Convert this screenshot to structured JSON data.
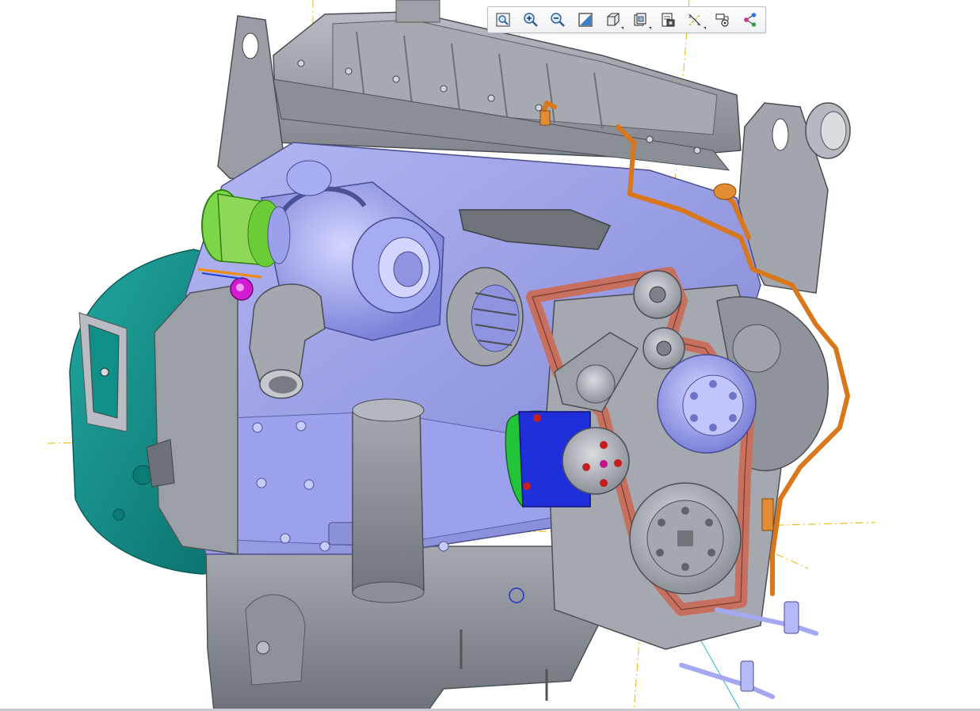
{
  "toolbar": {
    "buttons": [
      {
        "icon": "refit-icon",
        "tooltip": ""
      },
      {
        "icon": "zoom-in-icon",
        "tooltip": ""
      },
      {
        "icon": "zoom-out-icon",
        "tooltip": ""
      },
      {
        "icon": "repaint-icon",
        "tooltip": ""
      },
      {
        "icon": "display-style-icon",
        "tooltip": ""
      },
      {
        "icon": "saved-orientations-icon",
        "tooltip": ""
      },
      {
        "icon": "view-manager-icon",
        "tooltip": ""
      },
      {
        "icon": "datum-display-filters-icon",
        "tooltip": ""
      },
      {
        "icon": "spin-center-icon",
        "tooltip": ""
      },
      {
        "icon": "annotation-display-icon",
        "tooltip": ""
      }
    ]
  },
  "colors": {
    "block": "#9a9ee6",
    "head": "#8f949b",
    "bellhousing": "#0e8a84",
    "belt": "#c8705f",
    "harness": "#d9771c",
    "intake_ring": "#56c21e",
    "datum_axis": "#f0b400"
  }
}
